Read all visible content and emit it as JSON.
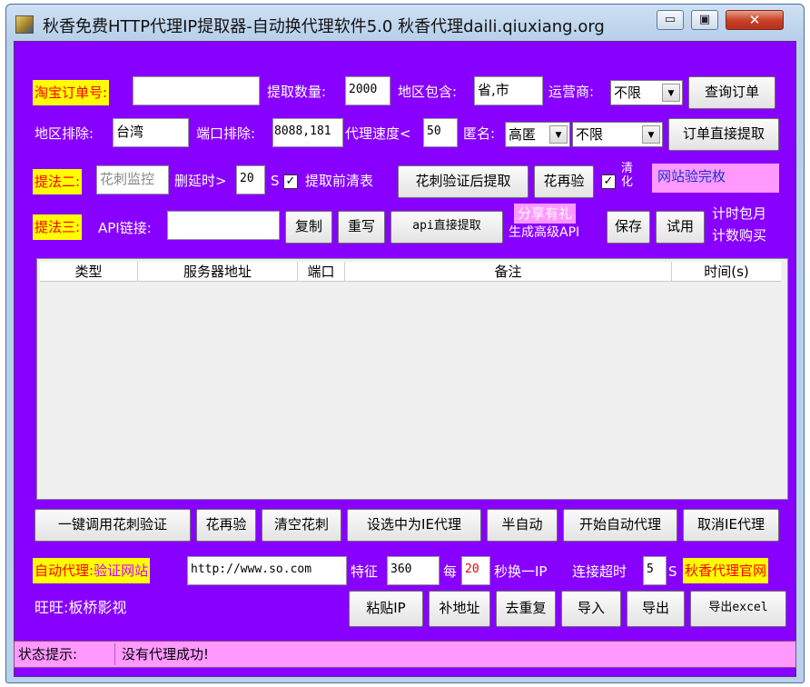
{
  "window": {
    "title": "秋香免费HTTP代理IP提取器-自动换代理软件5.0 秋香代理daili.qiuxiang.org",
    "min_symbol": "▭",
    "max_symbol": "▣",
    "close_symbol": "✕"
  },
  "row1": {
    "taobao_label": "淘宝订单号:",
    "taobao_value": "",
    "qty_label": "提取数量:",
    "qty_value": "2000",
    "region_include_label": "地区包含:",
    "region_include_value": "省,市",
    "carrier_label": "运营商:",
    "carrier_value": "不限",
    "query_button": "查询订单"
  },
  "row2": {
    "region_exclude_label": "地区排除:",
    "region_exclude_value": "台湾",
    "port_exclude_label": "端口排除:",
    "port_exclude_value": "8088,181",
    "speed_label": "代理速度<",
    "speed_value": "50",
    "anon_label": "匿名:",
    "anon_value": "高匿",
    "anon2_value": "不限",
    "direct_button": "订单直接提取"
  },
  "row3": {
    "method2_label": "提法二:",
    "method2_value": "花刺监控",
    "delay_label": "删延时>",
    "delay_value": "20",
    "delay_unit": "S",
    "clear_checkbox_mark": "✓",
    "clear_label": "提取前清表",
    "verify_extract_button": "花刺验证后提取",
    "again_button": "花再验",
    "purify_checkbox_mark": "✓",
    "purify_label": "清化",
    "site_verify_box": "网站验完枚"
  },
  "row4": {
    "method3_label": "提法三:",
    "api_label": "API链接:",
    "api_value": "",
    "copy_button": "复制",
    "rewrite_button": "重写",
    "api_extract_button": "api直接提取",
    "share_gift": "分享有礼",
    "gen_api": "生成高级API",
    "save_button": "保存",
    "trial_button": "试用",
    "monthly": "计时包月",
    "count_buy": "计数购买"
  },
  "table": {
    "columns": [
      "类型",
      "服务器地址",
      "端口",
      "备注",
      "时间(s)"
    ],
    "rows": []
  },
  "actions": {
    "one_click_verify": "一键调用花刺验证",
    "again": "花再验",
    "clear": "清空花刺",
    "set_ie_proxy": "设选中为IE代理",
    "semi_auto": "半自动",
    "start_auto": "开始自动代理",
    "cancel_ie": "取消IE代理"
  },
  "auto_row": {
    "auto_label": "自动代理:",
    "verify_site_label": "验证网站",
    "verify_site_value": "http://www.so.com",
    "feature_label": "特征",
    "feature_value": "360",
    "every_label": "每",
    "every_value": "20",
    "switch_label": "秒换一IP",
    "timeout_label": "连接超时",
    "timeout_value": "5",
    "timeout_unit": "S",
    "official_site": "秋香代理官网"
  },
  "bottom_row": {
    "wangwang": "旺旺:板桥影视",
    "paste_ip": "粘贴IP",
    "fill_address": "补地址",
    "dedupe": "去重复",
    "import": "导入",
    "export": "导出",
    "export_excel": "导出excel"
  },
  "status": {
    "label": "状态提示:",
    "text": "没有代理成功!"
  }
}
